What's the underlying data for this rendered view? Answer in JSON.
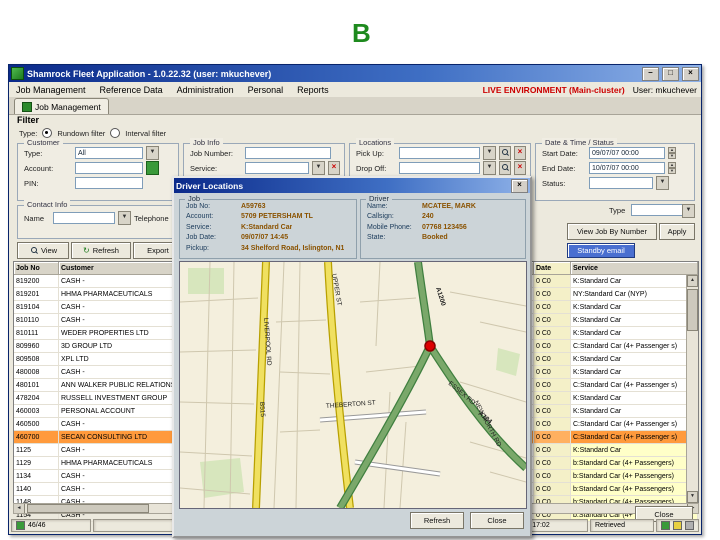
{
  "page": {
    "letter": "B"
  },
  "window": {
    "title": "Shamrock Fleet Application - 1.0.22.32 (user: mkuchever)",
    "min": "–",
    "max": "□",
    "close": "×"
  },
  "menu": {
    "items": [
      "Job Management",
      "Reference Data",
      "Administration",
      "Personal",
      "Reports"
    ],
    "environment": "LIVE ENVIRONMENT (Main-cluster)",
    "user": "User: mkuchever"
  },
  "tab": {
    "label": "Job Management"
  },
  "filter": {
    "title": "Filter",
    "type_label": "Type:",
    "radio_rundown": "Rundown filter",
    "radio_interval": "Interval filter",
    "customer": {
      "legend": "Customer",
      "type_label": "Type:",
      "type_value": "All",
      "account_label": "Account:",
      "pin_label": "PIN:"
    },
    "job_info": {
      "legend": "Job Info",
      "job_number_label": "Job Number:",
      "service_label": "Service:"
    },
    "locations": {
      "legend": "Locations",
      "pickup_label": "Pick Up:",
      "dropoff_label": "Drop Off:"
    },
    "datetime": {
      "legend": "Date & Time / Status",
      "start_label": "Start Date:",
      "start_value": "09/07/07 00:00",
      "end_label": "End Date:",
      "end_value": "10/07/07 00:00",
      "status_label": "Status:"
    },
    "contact": {
      "legend": "Contact Info",
      "name_label": "Name",
      "telephone_label": "Telephone"
    },
    "type2_label": "Type"
  },
  "toolbar": {
    "view": "View",
    "refresh": "Refresh",
    "export": "Export",
    "view_job_by_number": "View Job By Number",
    "apply": "Apply",
    "standby_email": "Standby email"
  },
  "grid": {
    "headers": {
      "job_no": "Job No",
      "customer": "Customer",
      "middle": "",
      "date": "Date",
      "service": "Service"
    },
    "rows": [
      {
        "job_no": "819200",
        "customer": "CASH -",
        "date": "0 C0",
        "service": "K:Standard Car"
      },
      {
        "job_no": "819201",
        "customer": "HHMA PHARMACEUTICALS",
        "date": "0 C0",
        "service": "NY:Standard Car (NYP)"
      },
      {
        "job_no": "819104",
        "customer": "CASH -",
        "date": "0 C0",
        "service": "K:Standard Car"
      },
      {
        "job_no": "810110",
        "customer": "CASH -",
        "date": "0 C0",
        "service": "K:Standard Car"
      },
      {
        "job_no": "810111",
        "customer": "WEDER PROPERTIES LTD",
        "date": "0 C0",
        "service": "K:Standard Car"
      },
      {
        "job_no": "809960",
        "customer": "3D GROUP LTD",
        "date": "0 C0",
        "service": "C:Standard Car (4+ Passenger s)"
      },
      {
        "job_no": "809508",
        "customer": "XPL LTD",
        "date": "0 C0",
        "service": "K:Standard Car"
      },
      {
        "job_no": "480008",
        "customer": "CASH -",
        "date": "0 C0",
        "service": "K:Standard Car"
      },
      {
        "job_no": "480101",
        "customer": "ANN WALKER PUBLIC RELATIONS LTD",
        "date": "0 C0",
        "service": "C:Standard Car (4+ Passenger s)"
      },
      {
        "job_no": "478204",
        "customer": "RUSSELL INVESTMENT GROUP",
        "date": "0 C0",
        "service": "K:Standard Car"
      },
      {
        "job_no": "460003",
        "customer": "PERSONAL ACCOUNT",
        "date": "0 C0",
        "service": "K:Standard Car"
      },
      {
        "job_no": "460500",
        "customer": "CASH -",
        "date": "0 C0",
        "service": "C:Standard Car (4+ Passenger s)"
      },
      {
        "job_no": "460700",
        "customer": "SECAN CONSULTING LTD",
        "date": "0 C0",
        "service": "C:Standard Car (4+ Passenger s)",
        "cls": "selected"
      },
      {
        "job_no": "1125",
        "customer": "CASH -",
        "date": "0 C0",
        "service": "K:Standard Car",
        "cls": "ybg"
      },
      {
        "job_no": "1129",
        "customer": "HHMA PHARMACEUTICALS",
        "date": "0 C0",
        "service": "b:Standard Car (4+ Passengers)",
        "cls": "ybg"
      },
      {
        "job_no": "1134",
        "customer": "CASH -",
        "date": "0 C0",
        "service": "b:Standard Car (4+ Passengers)",
        "cls": "ybg"
      },
      {
        "job_no": "1140",
        "customer": "CASH -",
        "date": "0 C0",
        "service": "b:Standard Car (4+ Passengers)",
        "cls": "ybg"
      },
      {
        "job_no": "1148",
        "customer": "CASH -",
        "date": "0 C0",
        "service": "b:Standard Car (4+ Passengers)",
        "cls": "ybg"
      },
      {
        "job_no": "1154",
        "customer": "CASH -",
        "date": "0 C0",
        "service": "b:Standard Car (4+ Passengers)",
        "cls": "ybg"
      }
    ]
  },
  "dialog": {
    "title": "Driver Locations",
    "close": "×",
    "job": {
      "legend": "Job",
      "fields": [
        {
          "l": "Job No:",
          "v": "A59763"
        },
        {
          "l": "Account:",
          "v": "5709 PETERSHAM TL"
        },
        {
          "l": "Service:",
          "v": "K:Standard Car"
        },
        {
          "l": "Job Date:",
          "v": "09/07/07 14:45"
        },
        {
          "l": "Pickup:",
          "v": "34 Shelford Road, Islington, N1"
        }
      ]
    },
    "driver": {
      "legend": "Driver",
      "fields": [
        {
          "l": "Name:",
          "v": "MCATEE, MARK"
        },
        {
          "l": "Callsign:",
          "v": "240"
        },
        {
          "l": "Mobile Phone:",
          "v": "07768 123456"
        },
        {
          "l": "State:",
          "v": "Booked"
        }
      ]
    },
    "map": {
      "labels": {
        "upper_st": "UPPER ST",
        "liverpool_rd": "LIVERPOOL RD",
        "b515": "B515",
        "essex_rd": "ESSEX RD",
        "a104": "A104",
        "a1200": "A1200",
        "new_north_rd": "NEW NORTH RD",
        "theberton_st": "THEBERTON ST"
      }
    },
    "buttons": {
      "refresh": "Refresh",
      "close": "Close"
    }
  },
  "footer": {
    "close": "Close"
  },
  "statusbar": {
    "left": "46/46",
    "time": "05/07/07 17:02",
    "state": "Retrieved"
  },
  "colors": {
    "live_env": "#cc0000",
    "selected_row": "#ff9a3c",
    "road_yellow": "#f0e060",
    "road_green": "#7aa86a",
    "marker": "#dd0000"
  }
}
